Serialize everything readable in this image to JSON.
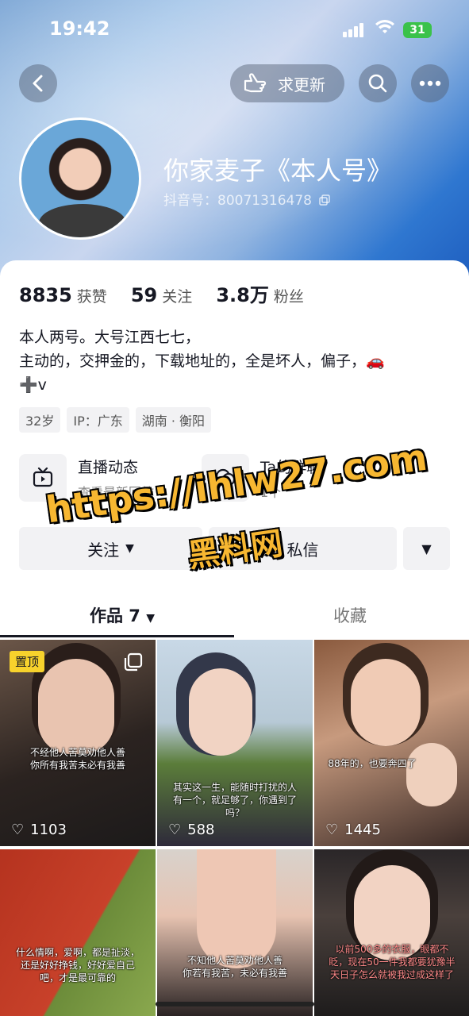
{
  "status_bar": {
    "time": "19:42",
    "battery": "31"
  },
  "nav": {
    "request_update": "求更新"
  },
  "profile": {
    "name": "你家麦子《本人号》",
    "douyin_id": "抖音号：80071316478"
  },
  "stats": [
    {
      "value": "8835",
      "label": "获赞"
    },
    {
      "value": "59",
      "label": "关注"
    },
    {
      "value": "3.8万",
      "label": "粉丝"
    }
  ],
  "bio": {
    "line1": "本人两号。大号江西七七，",
    "line2": "主动的，交押金的，下载地址的，全是坏人，偏子，🚗",
    "line3": "➕v"
  },
  "tags": [
    "32岁",
    "IP：广东",
    "湖南 · 衡阳"
  ],
  "features": [
    {
      "title": "直播动态",
      "subtitle": "查看最新回放"
    },
    {
      "title": "Ta的群聊",
      "subtitle": "1个"
    }
  ],
  "actions": {
    "follow": "关注",
    "message": "私信"
  },
  "tabs": {
    "works": "作品 7",
    "favorites": "收藏"
  },
  "videos": [
    {
      "pinned": "置顶",
      "caption": "不经他人苦莫劝他人善\n你所有我苦未必有我善",
      "likes": "1103"
    },
    {
      "caption": "其实这一生，能随时打扰的人\n有一个，就足够了，你遇到了\n吗？",
      "likes": "588"
    },
    {
      "caption": "88年的，也要奔四了",
      "likes": "1445"
    },
    {
      "caption": "什么情啊，爱啊，都是扯淡，\n还是好好挣钱，好好爱自己\n吧，才是最可靠的",
      "likes": ""
    },
    {
      "caption": "不知他人苦莫劝他人善\n你若有我苦，未必有我善",
      "likes": ""
    },
    {
      "caption": "以前500多的衣服，眼都不\n眨，现在50一件我都要犹豫半\n天日子怎么就被我过成这样了",
      "likes": ""
    }
  ],
  "watermark": {
    "url": "https://ihlw27.com",
    "name": "黑料网"
  }
}
